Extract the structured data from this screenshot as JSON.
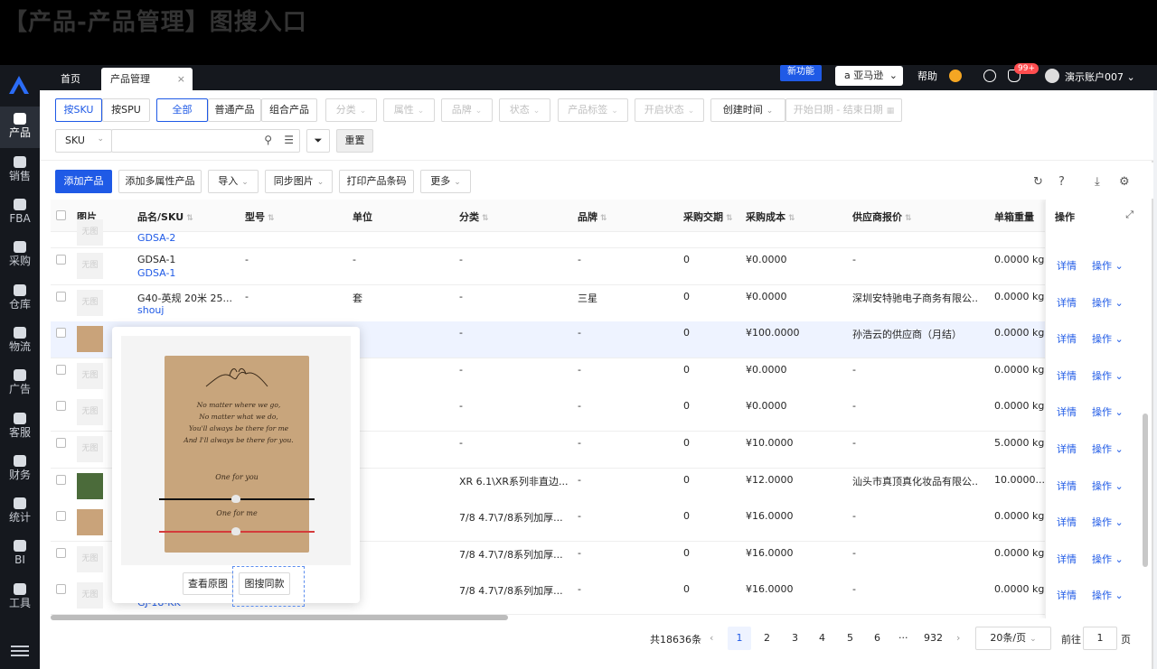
{
  "banner": {
    "title": "【产品-产品管理】图搜入口"
  },
  "sidebar": {
    "items": [
      {
        "label": "产品",
        "icon": "product-icon"
      },
      {
        "label": "销售",
        "icon": "sales-icon"
      },
      {
        "label": "FBA",
        "icon": "fba-icon"
      },
      {
        "label": "采购",
        "icon": "purchase-icon"
      },
      {
        "label": "仓库",
        "icon": "warehouse-icon"
      },
      {
        "label": "物流",
        "icon": "logistics-icon"
      },
      {
        "label": "广告",
        "icon": "ad-icon"
      },
      {
        "label": "客服",
        "icon": "service-icon"
      },
      {
        "label": "财务",
        "icon": "finance-icon"
      },
      {
        "label": "统计",
        "icon": "stats-icon"
      },
      {
        "label": "BI",
        "icon": "bi-icon"
      },
      {
        "label": "工具",
        "icon": "tools-icon"
      }
    ]
  },
  "topbar": {
    "tabs": [
      "首页",
      "产品管理"
    ],
    "close": "×",
    "new_feature": "新功能",
    "store": "亚马逊",
    "help": "帮助",
    "badge": "99+",
    "account": "演示账户007"
  },
  "filters": {
    "by_sku": "按SKU",
    "by_spu": "按SPU",
    "type_all": "全部",
    "type_normal": "普通产品",
    "type_combo": "组合产品",
    "category": "分类",
    "attribute": "属性",
    "brand": "品牌",
    "status": "状态",
    "tag": "产品标签",
    "enable_status": "开启状态",
    "created_time": "创建时间",
    "date_range": "开始日期 - 结束日期",
    "search_field": "SKU",
    "search_placeholder": "",
    "reset": "重置"
  },
  "toolbar": {
    "add": "添加产品",
    "add_multi": "添加多属性产品",
    "import": "导入",
    "sync_image": "同步图片",
    "print_barcode": "打印产品条码",
    "more": "更多"
  },
  "table": {
    "headers": [
      "图片",
      "品名/SKU",
      "型号",
      "单位",
      "分类",
      "品牌",
      "采购交期",
      "采购成本",
      "供应商报价",
      "单箱重量",
      "操作"
    ],
    "top_partial_sku": "GDSA-2",
    "rows": [
      {
        "name": "GDSA-1",
        "sku": "GDSA-1",
        "model": "-",
        "unit": "-",
        "category": "-",
        "brand": "-",
        "lead": "0",
        "cost": "¥0.0000",
        "supplier": "-",
        "weight": "0.0000 kg"
      },
      {
        "name": "G40-英规 20米 25...",
        "sku": "shouj",
        "model": "-",
        "unit": "套",
        "category": "-",
        "brand": "三星",
        "lead": "0",
        "cost": "¥0.0000",
        "supplier": "深圳安特驰电子商务有限公...",
        "weight": "0.0000 kg"
      },
      {
        "name": "",
        "sku": "",
        "model": "",
        "unit": "",
        "category": "-",
        "brand": "-",
        "lead": "0",
        "cost": "¥100.0000",
        "supplier": "孙浩云的供应商（月结）",
        "weight": "0.0000 kg"
      },
      {
        "name": "",
        "sku": "",
        "model": "",
        "unit": "",
        "category": "-",
        "brand": "-",
        "lead": "0",
        "cost": "¥0.0000",
        "supplier": "-",
        "weight": "0.0000 kg"
      },
      {
        "name": "",
        "sku": "",
        "model": "",
        "unit": "",
        "category": "-",
        "brand": "-",
        "lead": "0",
        "cost": "¥0.0000",
        "supplier": "-",
        "weight": "0.0000 kg"
      },
      {
        "name": "",
        "sku": "",
        "model": "",
        "unit": "",
        "category": "-",
        "brand": "-",
        "lead": "0",
        "cost": "¥10.0000",
        "supplier": "-",
        "weight": "5.0000 kg"
      },
      {
        "name": "",
        "sku": "",
        "model": "",
        "unit": "",
        "category": "XR 6.1\\XR系列非直边...",
        "brand": "-",
        "lead": "0",
        "cost": "¥12.0000",
        "supplier": "汕头市真顶真化妆品有限公...",
        "weight": "10.0000..."
      },
      {
        "name": "",
        "sku": "",
        "model": "",
        "unit": "",
        "category": "7/8 4.7\\7/8系列加厚...",
        "brand": "-",
        "lead": "0",
        "cost": "¥16.0000",
        "supplier": "-",
        "weight": "0.0000 kg"
      },
      {
        "name": "",
        "sku": "",
        "model": "",
        "unit": "",
        "category": "7/8 4.7\\7/8系列加厚...",
        "brand": "-",
        "lead": "0",
        "cost": "¥16.0000",
        "supplier": "-",
        "weight": "0.0000 kg"
      },
      {
        "name": "",
        "sku": "GJ-18-KK",
        "model": "",
        "unit": "",
        "category": "7/8 4.7\\7/8系列加厚...",
        "brand": "-",
        "lead": "0",
        "cost": "¥16.0000",
        "supplier": "-",
        "weight": "0.0000 kg"
      }
    ],
    "thumb_placeholder": "无图",
    "detail": "详情",
    "action": "操作"
  },
  "pagination": {
    "total": "共18636条",
    "pages": [
      "1",
      "2",
      "3",
      "4",
      "5",
      "6",
      "···",
      "932"
    ],
    "page_size": "20条/页",
    "goto": "前往",
    "goto_value": "1",
    "page_unit": "页"
  },
  "popup": {
    "poem": [
      "No matter where we go,",
      "No matter what we do,",
      "You'll always be there for me",
      "And I'll always be there for you."
    ],
    "for_you": "One for you",
    "for_me": "One for me",
    "view_original": "查看原图",
    "image_search": "图搜同款"
  }
}
